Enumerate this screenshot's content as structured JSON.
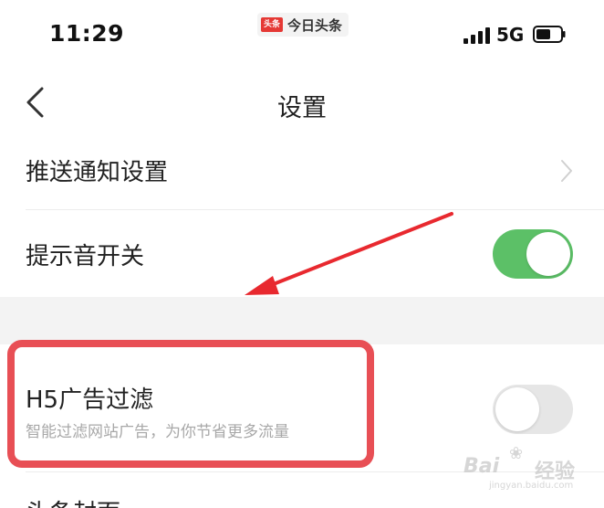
{
  "status_bar": {
    "time": "11:29",
    "app_logo_text": "头条",
    "app_name": "今日头条",
    "network": "5G",
    "signal_icon": "signal-bars-icon",
    "battery_icon": "battery-icon"
  },
  "nav": {
    "title": "设置",
    "back_icon": "chevron-left-icon"
  },
  "settings": {
    "push_label": "推送通知设置",
    "sound_label": "提示音开关",
    "sound_on": true,
    "h5_label": "H5广告过滤",
    "h5_description": "智能过滤网站广告，为你节省更多流量",
    "h5_on": false,
    "cover_label": "头条封面"
  },
  "annotation": {
    "highlight_color": "#e84f55",
    "arrow_color": "#e8292f"
  },
  "watermark": {
    "brand": "Bai",
    "brand_suffix": "经验",
    "url": "jingyan.baidu.com"
  },
  "colors": {
    "toggle_on": "#5cc067",
    "toggle_off": "#e6e6e6",
    "section_gap": "#f3f3f3"
  }
}
